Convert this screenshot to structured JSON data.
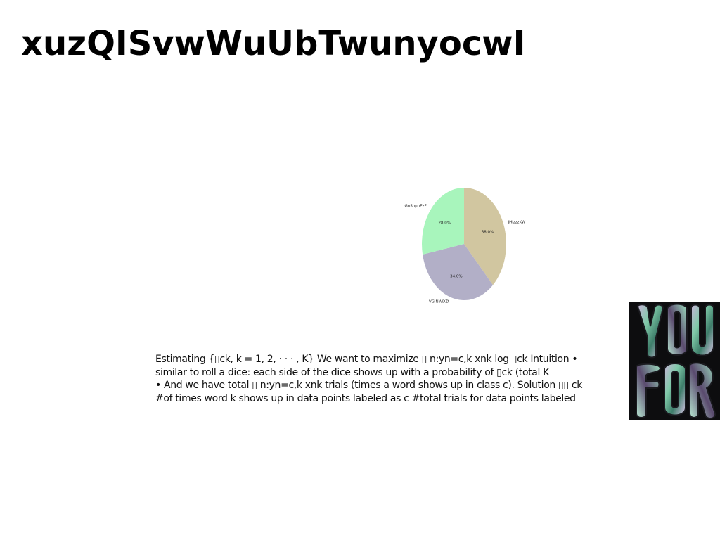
{
  "page": {
    "title": "xuzQISvwWuUbTwunyocwI"
  },
  "chart_data": {
    "type": "pie",
    "title": "",
    "categories": [
      "JHIzzzKW",
      "VGlNWDZt",
      "GnShpnEzFl"
    ],
    "values": [
      38.0,
      34.0,
      28.0
    ],
    "value_labels": [
      "38.0%",
      "34.0%",
      "28.0%"
    ],
    "colors": [
      "#d1c6a0",
      "#b2afc7",
      "#a8f5bc"
    ],
    "start_angle_deg": 90,
    "direction": "clockwise",
    "legend": "none"
  },
  "body_text": {
    "lines": [
      "Estimating {▯ck, k = 1, 2, · · · , K} We want to maximize ▯ n:yn=c,k xnk log ▯ck Intuition •",
      "similar to roll a dice: each side of the dice shows up with a probability of ▯ck (total K",
      "• And we have total ▯ n:yn=c,k xnk trials (times a word shows up in class c). Solution ▯▯ ck",
      "#of times word k shows up in data points labeled as c #total trials for data points labeled"
    ]
  },
  "side_image": {
    "text": "YOU FOR",
    "colors": [
      "#0d0d0f",
      "#7fc9a8",
      "#c8b4d8",
      "#3e7d6a"
    ]
  }
}
